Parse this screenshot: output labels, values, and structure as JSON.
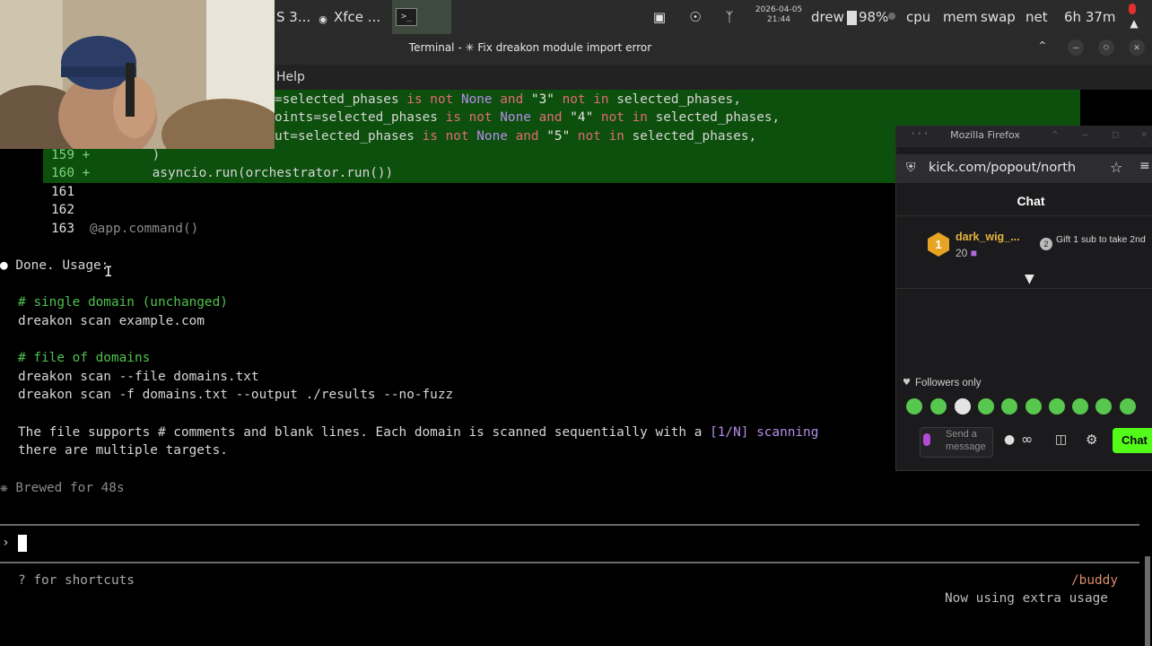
{
  "panel": {
    "taskbar_item1": "S 3...",
    "taskbar_item2": "Xfce ...",
    "date": "2026-04-05",
    "time": "21:44",
    "user": "drew",
    "battery": "98%",
    "monitors": [
      "cpu",
      "mem",
      "swap",
      "net"
    ],
    "uptime": "6h 37m"
  },
  "terminal": {
    "window_title": "Terminal - ✳ Fix dreakon module import error",
    "menu_help": "Help",
    "diff": [
      {
        "text": "=selected_phases",
        "a": " is not ",
        "b": "None",
        "c": " and ",
        "d": "\"3\"",
        "e": " not in ",
        "f": "selected_phases,"
      },
      {
        "text": "oints=selected_phases",
        "a": " is not ",
        "b": "None",
        "c": " and ",
        "d": "\"4\"",
        "e": " not in ",
        "f": "selected_phases,"
      },
      {
        "text": "ut=selected_phases",
        "a": " is not ",
        "b": "None",
        "c": " and ",
        "d": "\"5\"",
        "e": " not in ",
        "f": "selected_phases,"
      }
    ],
    "l159_num": "159 +",
    "l159_code": "        )",
    "l160_num": "160 +",
    "l160_code": "        asyncio.run(orchestrator.run())",
    "l161": "161",
    "l162": "162",
    "l163_num": "163",
    "l163_code": "@app.command()",
    "done": "Done. Usage:",
    "c1": "# single domain (unchanged)",
    "cmd1": "dreakon scan example.com",
    "c2": "# file of domains",
    "cmd2": "dreakon scan --file domains.txt",
    "cmd3": "dreakon scan -f domains.txt --output ./results --no-fuzz",
    "desc1a": "The file supports # comments and blank lines. Each domain is scanned sequentially with a ",
    "desc1b": "[1/N] scanning",
    "desc2": "there are multiple targets.",
    "brewed": "Brewed for 48s",
    "prompt": "›",
    "shortcuts": "? for shortcuts",
    "buddy": "/buddy",
    "extra_usage": "Now using extra usage"
  },
  "firefox": {
    "title": "Mozilla Firefox",
    "url": "kick.com/popout/north",
    "chat_header": "Chat",
    "gift_user": "dark_wig_...",
    "gift_count": "20",
    "rank": "1",
    "gift_cta": "Gift 1 sub to take 2nd",
    "followers_only": "Followers only",
    "send_placeholder": "Send a message",
    "chat_button": "Chat"
  },
  "colors": {
    "diff_green": "#0d4f0d",
    "kick_green": "#53fc18",
    "keyword_red": "#e06c75",
    "comment_green": "#4ec24e"
  }
}
